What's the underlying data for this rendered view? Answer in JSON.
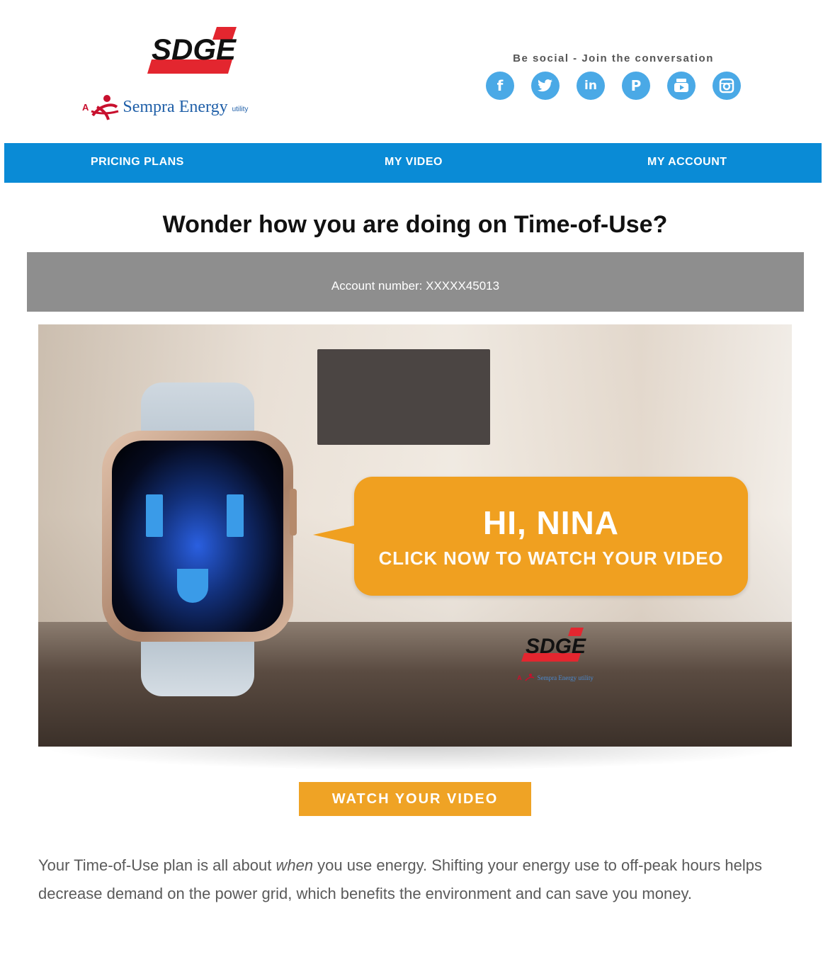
{
  "header": {
    "logo_text": "SDGE",
    "sempra_prefix": "A",
    "sempra_name": "Sempra Energy",
    "sempra_suffix": "utility",
    "social_title": "Be social - Join the conversation",
    "social_icons": [
      {
        "name": "facebook-icon",
        "glyph": "f"
      },
      {
        "name": "twitter-icon",
        "glyph": "🐦"
      },
      {
        "name": "linkedin-icon",
        "glyph": "in"
      },
      {
        "name": "pinterest-icon",
        "glyph": "P"
      },
      {
        "name": "youtube-icon",
        "glyph": "▶"
      },
      {
        "name": "instagram-icon",
        "glyph": "◙"
      }
    ]
  },
  "nav": {
    "pricing_plans": "PRICING PLANS",
    "my_video": "MY VIDEO",
    "my_account": "MY ACCOUNT"
  },
  "main": {
    "headline": "Wonder how you are doing on Time-of-Use?",
    "account_label": "Account number: XXXXX45013",
    "bubble_greeting": "HI, NINA",
    "bubble_cta": "CLICK NOW TO WATCH YOUR VIDEO",
    "hero_logo_text": "SDGE",
    "hero_logo_sub": "Sempra Energy utility",
    "watch_button": "WATCH YOUR VIDEO",
    "copy_part1": "Your Time-of-Use plan is all about ",
    "copy_em": "when",
    "copy_part2": " you use energy. Shifting your energy use to off-peak hours helps decrease demand on the power grid, which benefits the environment and can save you money."
  },
  "colors": {
    "nav_blue": "#0a8bd6",
    "social_blue": "#4aa9e6",
    "brand_red": "#c8102e",
    "accent_orange": "#f0a020",
    "account_gray": "#8e8e8e"
  }
}
